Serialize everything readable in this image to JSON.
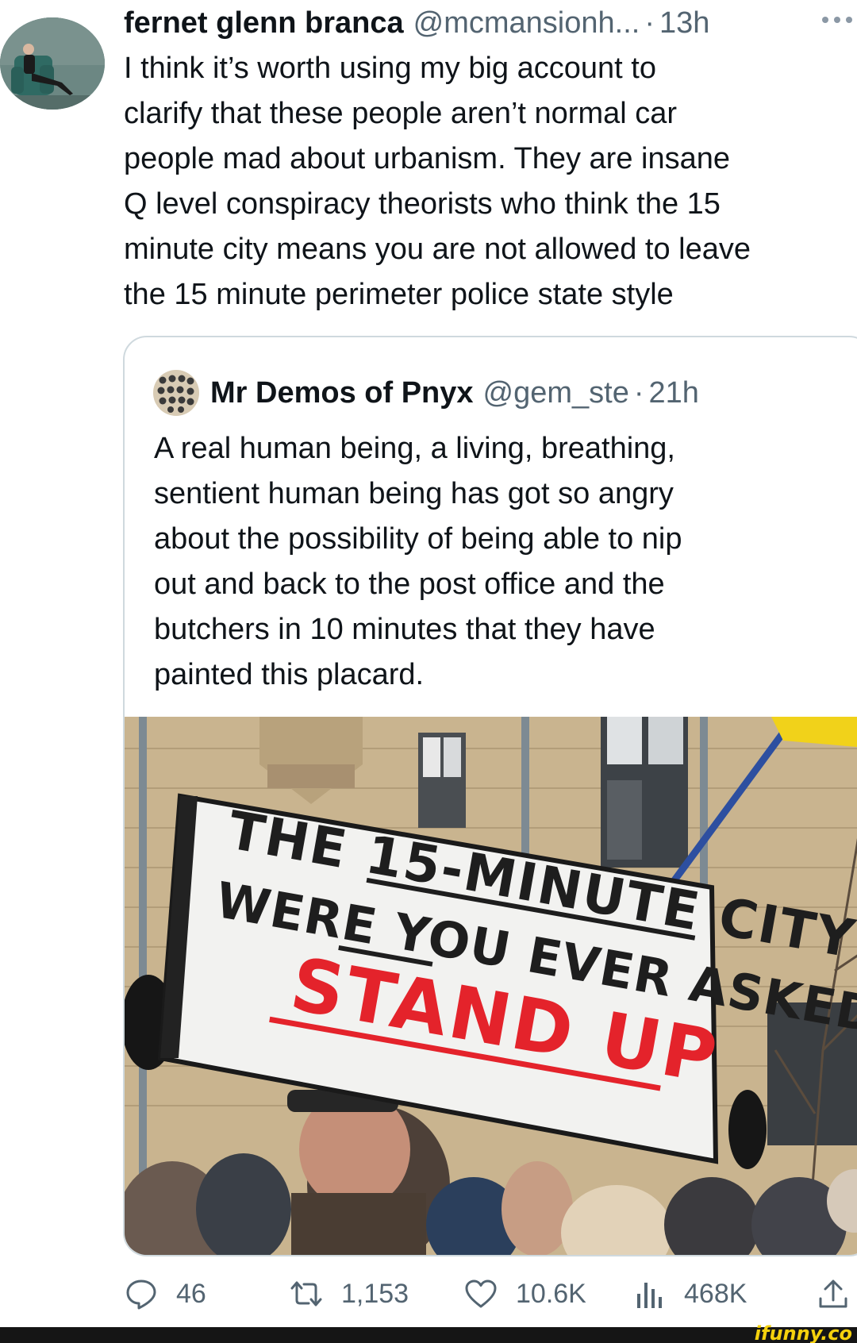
{
  "tweet": {
    "display_name": "fernet glenn branca",
    "handle": "@mcmansionh...",
    "separator": "·",
    "time": "13h",
    "more_icon": "ellipsis-icon",
    "lines": [
      "I think it’s worth using my big account to",
      "clarify that these people aren’t normal car",
      "people mad about urbanism. They are insane",
      "Q level conspiracy theorists who think the 15",
      "minute city means you are not allowed to leave",
      "the 15 minute perimeter police state style"
    ]
  },
  "quote": {
    "display_name": "Mr Demos of Pnyx",
    "handle": "@gem_ste",
    "separator": "·",
    "time": "21h",
    "lines": [
      "A real human being, a living, breathing,",
      "sentient human being has got so angry",
      "about the possibility of being able to nip",
      "out and back to the post office and the",
      "butchers in 10 minutes that they have",
      "painted this placard."
    ],
    "placard": {
      "line1": "THE 15-MINUTE CITY",
      "line2": "WERE YOU EVER ASKED?",
      "line3": "STAND UP"
    }
  },
  "actions": {
    "reply": {
      "icon": "reply-icon",
      "count": "46"
    },
    "retweet": {
      "icon": "retweet-icon",
      "count": "1,153"
    },
    "like": {
      "icon": "heart-icon",
      "count": "10.6K"
    },
    "views": {
      "icon": "views-icon",
      "count": "468K"
    },
    "share": {
      "icon": "share-icon"
    }
  },
  "watermark": "ifunny.co",
  "colors": {
    "text": "#0f1419",
    "secondary": "#536471",
    "border": "#cfd9de",
    "placard_red": "#e4232b",
    "watermark": "#f5d10d"
  }
}
